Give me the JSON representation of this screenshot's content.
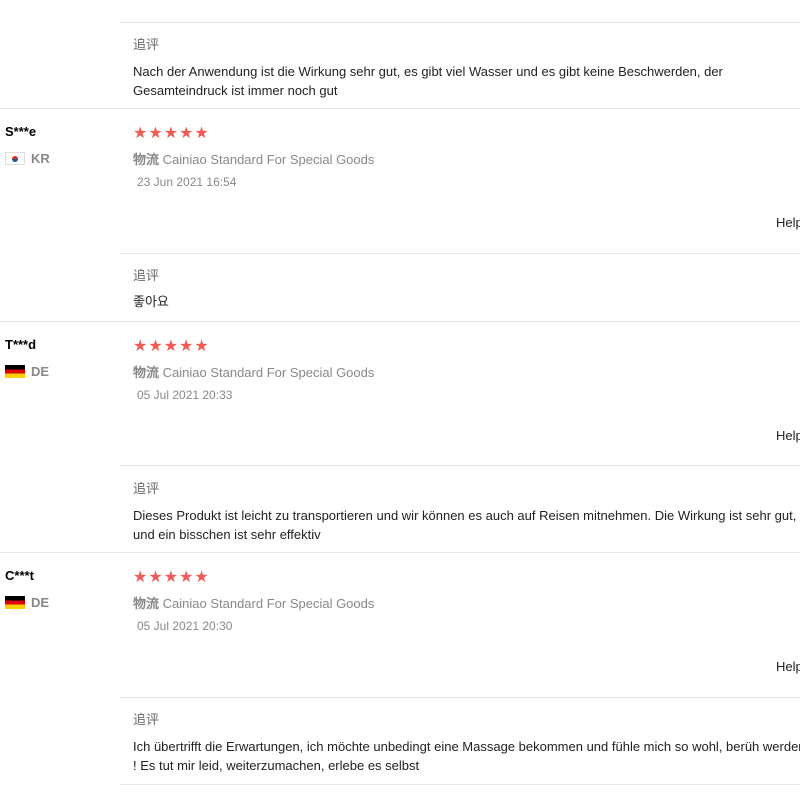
{
  "top_review": {
    "followup_label": "追评",
    "followup_text": "Nach der Anwendung ist die Wirkung sehr gut, es gibt viel Wasser und es gibt keine Beschwerden, der Gesamteindruck ist immer noch gut"
  },
  "reviews": [
    {
      "user": "S***e",
      "country": "KR",
      "flag": "kr",
      "stars": "★★★★★",
      "rating": 5,
      "logistics_label": "物流",
      "logistics_value": "Cainiao Standard For Special Goods",
      "date": "23 Jun 2021 16:54",
      "helpful": "Help",
      "followup_label": "追评",
      "followup_text": "좋아요"
    },
    {
      "user": "T***d",
      "country": "DE",
      "flag": "de",
      "stars": "★★★★★",
      "rating": 5,
      "logistics_label": "物流",
      "logistics_value": "Cainiao Standard For Special Goods",
      "date": "05 Jul 2021 20:33",
      "helpful": "Help",
      "followup_label": "追评",
      "followup_text": "Dieses Produkt ist leicht zu transportieren und wir können es auch auf Reisen mitnehmen. Die Wirkung ist sehr gut, und ein bisschen ist sehr effektiv"
    },
    {
      "user": "C***t",
      "country": "DE",
      "flag": "de",
      "stars": "★★★★★",
      "rating": 5,
      "logistics_label": "物流",
      "logistics_value": "Cainiao Standard For Special Goods",
      "date": "05 Jul 2021 20:30",
      "helpful": "Help",
      "followup_label": "追评",
      "followup_text": "Ich übertrifft die Erwartungen, ich möchte unbedingt eine Massage bekommen und fühle mich so wohl, berüh werden! ! Es tut mir leid, weiterzumachen, erlebe es selbst"
    }
  ]
}
